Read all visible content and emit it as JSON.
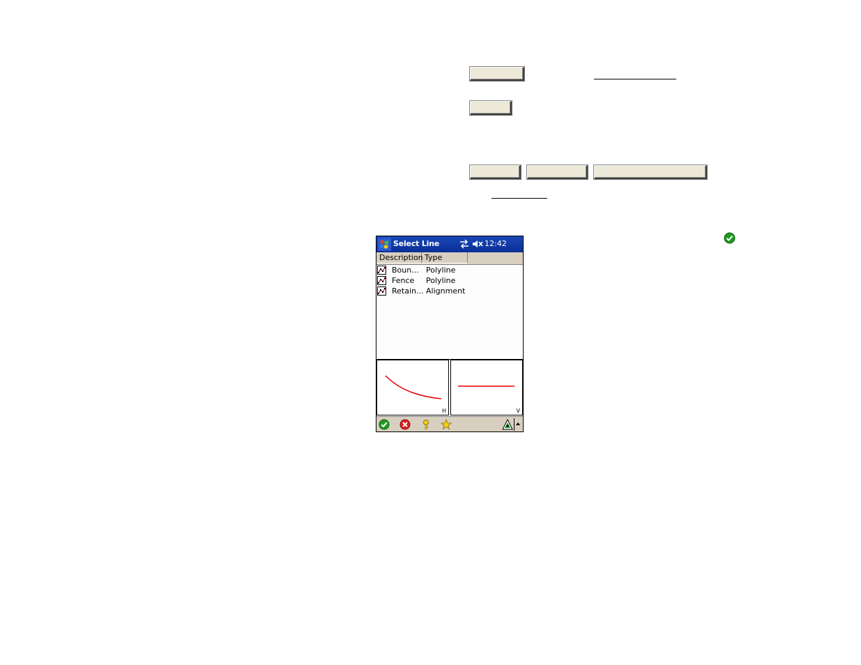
{
  "document": {
    "buttons": [
      {
        "name": "doc-button-1"
      },
      {
        "name": "doc-button-2"
      },
      {
        "name": "doc-button-3"
      },
      {
        "name": "doc-button-4"
      },
      {
        "name": "doc-button-5"
      }
    ],
    "check_icon": "green-check-icon"
  },
  "pda": {
    "title": "Select Line",
    "clock": "12:42",
    "icons": {
      "start": "windows-flag-icon",
      "connectivity": "connection-arrows-icon",
      "volume": "speaker-muted-icon"
    },
    "columns": [
      "Description",
      "Type"
    ],
    "rows": [
      {
        "description": "Boun...",
        "type": "Polyline"
      },
      {
        "description": "Fence",
        "type": "Polyline"
      },
      {
        "description": "Retain...",
        "type": "Alignment"
      }
    ],
    "views": {
      "horizontal_label": "H",
      "vertical_label": "V"
    },
    "toolbar": [
      {
        "icon": "accept-check-icon"
      },
      {
        "icon": "cancel-x-icon"
      },
      {
        "icon": "help-key-icon"
      },
      {
        "icon": "favorite-star-icon"
      },
      {
        "icon": "survey-triangle-icon"
      },
      {
        "icon": "up-arrow-icon"
      }
    ],
    "colors": {
      "titlebar": "#0a2f95",
      "chrome": "#d8cfc0",
      "plot_line": "#e00000"
    }
  }
}
